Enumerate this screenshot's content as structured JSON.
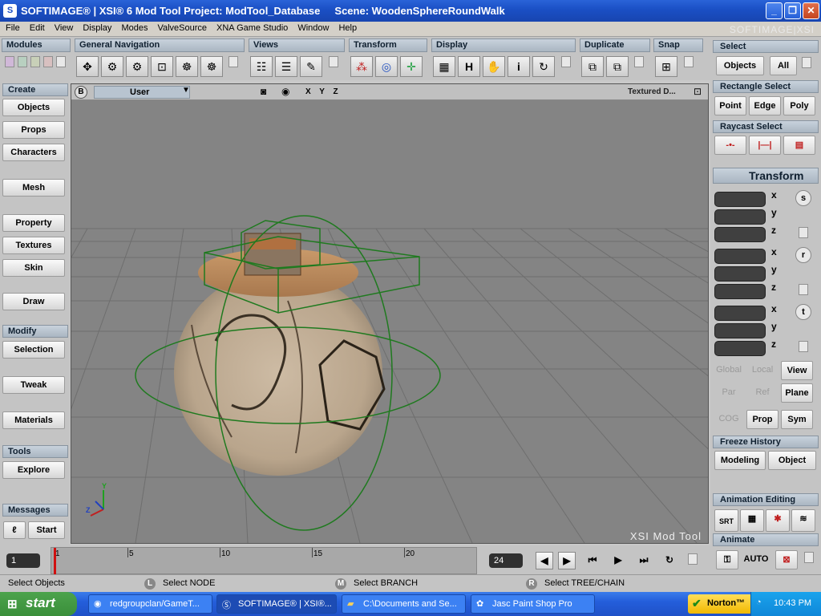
{
  "window": {
    "title": "SOFTIMAGE® | XSI® 6 Mod Tool Project: ModTool_Database     Scene: WoodenSphereRoundWalk",
    "app_icon": "S"
  },
  "menu": [
    "File",
    "Edit",
    "View",
    "Display",
    "Modes",
    "ValveSource",
    "XNA Game Studio",
    "Window",
    "Help"
  ],
  "brand": "SOFTIMAGE|XSI",
  "toolbar": {
    "groups": [
      "Modules",
      "General Navigation",
      "Views",
      "Transform",
      "Display",
      "Duplicate",
      "Snap"
    ]
  },
  "left_panel": {
    "create_header": "Create",
    "create_buttons": [
      "Objects",
      "Props",
      "Characters",
      "Mesh",
      "Property",
      "Textures",
      "Skin",
      "Draw"
    ],
    "modify_header": "Modify",
    "modify_buttons": [
      "Selection",
      "Tweak",
      "Materials"
    ],
    "tools_header": "Tools",
    "tools_buttons": [
      "Explore"
    ],
    "messages_header": "Messages",
    "start_label": "Start"
  },
  "viewport": {
    "badge": "B",
    "camera": "User",
    "axes": "X Y Z",
    "display_mode": "Textured D...",
    "watermark": "XSI Mod Tool"
  },
  "right_panel": {
    "select_header": "Select",
    "objects": "Objects",
    "all": "All",
    "rect_header": "Rectangle Select",
    "point": "Point",
    "edge": "Edge",
    "poly": "Poly",
    "raycast_header": "Raycast Select",
    "transform_header": "Transform",
    "axes": [
      "x",
      "y",
      "z"
    ],
    "transform_buttons": [
      "s",
      "r",
      "t"
    ],
    "global": "Global",
    "local": "Local",
    "view": "View",
    "par": "Par",
    "ref": "Ref",
    "plane": "Plane",
    "cog": "COG",
    "prop": "Prop",
    "sym": "Sym",
    "freeze_header": "Freeze History",
    "modeling": "Modeling",
    "object": "Object",
    "anim_edit_header": "Animation Editing",
    "srt": "SRT",
    "animate_header": "Animate",
    "auto": "AUTO"
  },
  "timeline": {
    "current_frame": "1",
    "end_frame": "24",
    "ticks": [
      "1",
      "5",
      "10",
      "15",
      "20"
    ]
  },
  "status": {
    "left": "Select Objects",
    "l_mark": "L",
    "l_text": "Select NODE",
    "m_mark": "M",
    "m_text": "Select BRANCH",
    "r_mark": "R",
    "r_text": "Select TREE/CHAIN"
  },
  "taskbar": {
    "start": "start",
    "tasks": [
      "redgroupclan/GameT...",
      "SOFTIMAGE® | XSI®...",
      "C:\\Documents and Se...",
      "Jasc Paint Shop Pro"
    ],
    "norton": "Norton™",
    "clock": "10:43 PM"
  }
}
